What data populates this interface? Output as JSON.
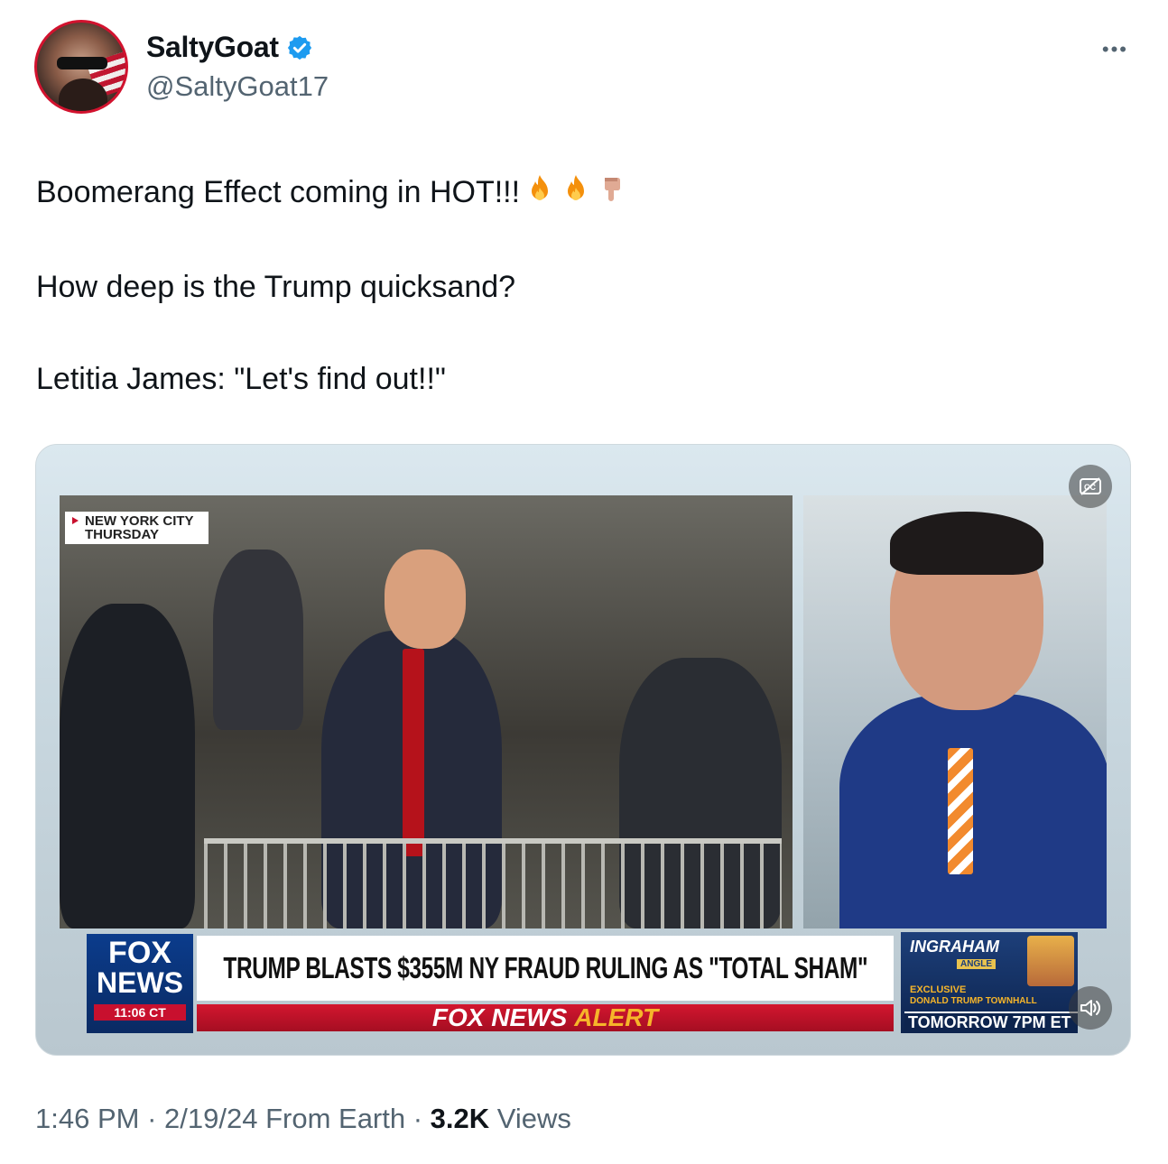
{
  "tweet": {
    "author": {
      "display_name": "SaltyGoat",
      "handle": "@SaltyGoat17",
      "verified": true
    },
    "more_icon": "more-horizontal-icon",
    "text_lines": [
      "Boomerang Effect coming in HOT!!!",
      "How deep is the Trump quicksand?",
      "Letitia James: \"Let's find out!!\""
    ],
    "emojis": [
      "fire",
      "fire",
      "backhand-index-pointing-down"
    ],
    "media": {
      "type": "video",
      "location_bug": [
        "NEW YORK CITY",
        "THURSDAY"
      ],
      "network_logo": [
        "FOX",
        "NEWS"
      ],
      "clock": "11:06 CT",
      "headline": "TRUMP BLASTS $355M NY FRAUD RULING AS \"TOTAL SHAM\"",
      "alert_prefix": "FOX NEWS",
      "alert_word": "ALERT",
      "promo": {
        "show": "INGRAHAM",
        "subtitle": "ANGLE",
        "exclusive": "EXCLUSIVE",
        "event": "DONALD TRUMP TOWNHALL",
        "when": "TOMORROW 7PM ET"
      },
      "captions_icon": "closed-captions-off-icon",
      "volume_icon": "volume-icon"
    },
    "meta": {
      "time": "1:46 PM",
      "date": "2/19/24",
      "source": "From Earth",
      "views_count": "3.2K",
      "views_label": "Views"
    },
    "colors": {
      "verified_blue": "#1d9bf0",
      "secondary_text": "#536471",
      "primary_text": "#0f1419",
      "fox_red": "#c8102e",
      "fox_blue": "#0b3c8c"
    }
  }
}
